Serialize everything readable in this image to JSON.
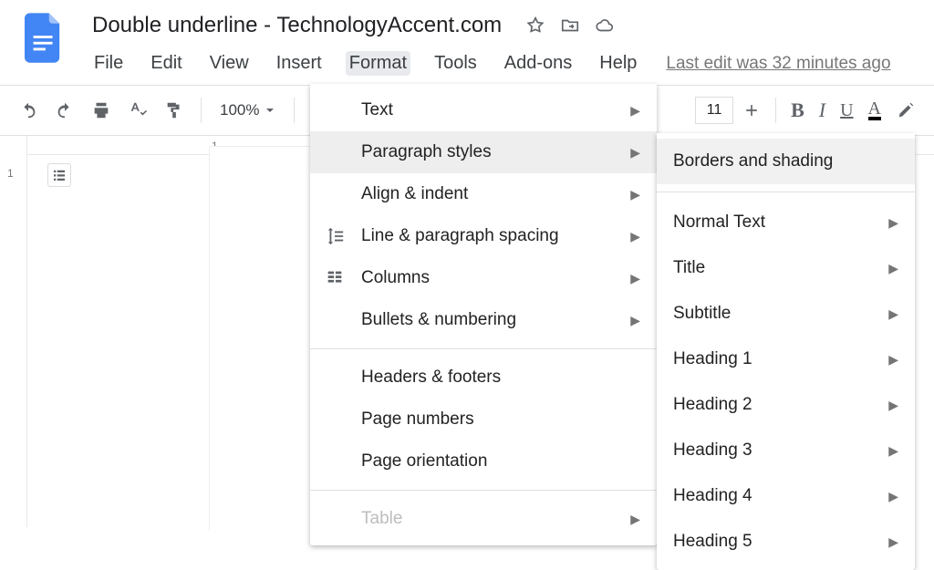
{
  "doc_title": "Double underline - TechnologyAccent.com",
  "menubar": {
    "file": "File",
    "edit": "Edit",
    "view": "View",
    "insert": "Insert",
    "format": "Format",
    "tools": "Tools",
    "addons": "Add-ons",
    "help": "Help"
  },
  "last_edit": "Last edit was 32 minutes ago",
  "toolbar": {
    "zoom": "100%",
    "font_size": "11",
    "bold_glyph": "B",
    "italic_glyph": "I",
    "underline_glyph": "U",
    "text_color_glyph": "A"
  },
  "format_menu": {
    "text": "Text",
    "paragraph_styles": "Paragraph styles",
    "align_indent": "Align & indent",
    "line_spacing": "Line & paragraph spacing",
    "columns": "Columns",
    "bullets_numbering": "Bullets & numbering",
    "headers_footers": "Headers & footers",
    "page_numbers": "Page numbers",
    "page_orientation": "Page orientation",
    "table": "Table"
  },
  "paragraph_submenu": {
    "borders_shading": "Borders and shading",
    "normal_text": "Normal Text",
    "title": "Title",
    "subtitle": "Subtitle",
    "heading_1": "Heading 1",
    "heading_2": "Heading 2",
    "heading_3": "Heading 3",
    "heading_4": "Heading 4",
    "heading_5": "Heading 5"
  },
  "ruler": {
    "top_1": "1"
  }
}
